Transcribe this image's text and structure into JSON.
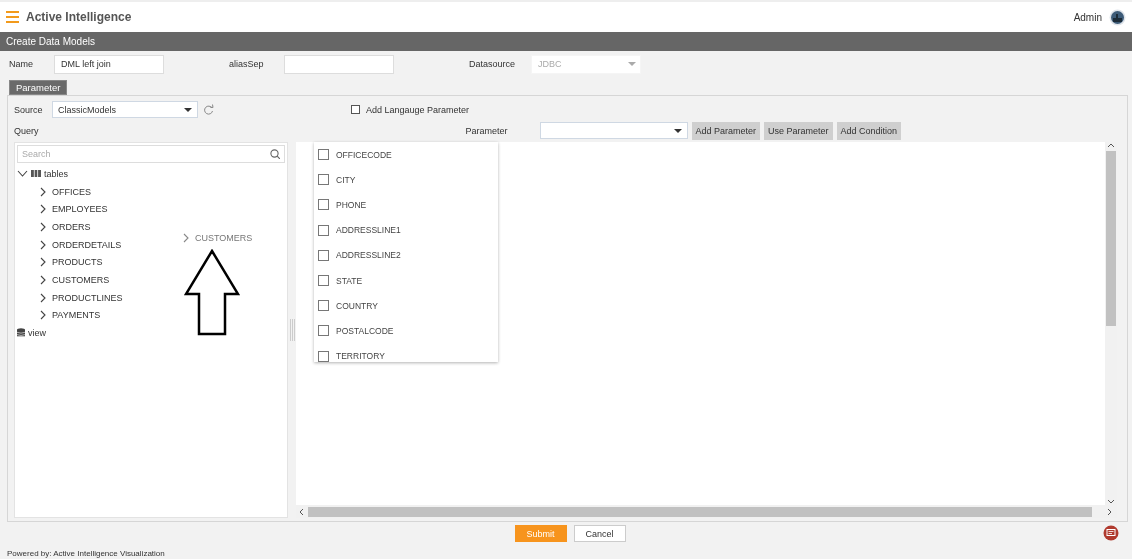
{
  "header": {
    "title": "Active Intelligence",
    "user": "Admin"
  },
  "page_title": "Create Data Models",
  "fields": [
    {
      "label": "Name",
      "kind": "text",
      "value": "DML left join"
    },
    {
      "label": "aliasSep",
      "kind": "text"
    },
    {
      "label": "Datasource",
      "kind": "select",
      "value": "JDBC",
      "disabled": true
    }
  ],
  "tabs": [
    {
      "label": "Parameter",
      "selected": true
    }
  ],
  "source": {
    "label": "Source",
    "value": "ClassicModels"
  },
  "language_checkbox": {
    "label": "Add Langauge Parameter",
    "checked": false
  },
  "query_label": "Query",
  "parameter": {
    "label": "Parameter"
  },
  "parameter_buttons": [
    "Add Parameter",
    "Use Parameter",
    "Add Condition"
  ],
  "tree": {
    "search": {
      "placeholder": "Search"
    },
    "nodes": [
      {
        "label": "tables",
        "kind": "table",
        "expanded": true,
        "children": [
          {
            "label": "OFFICES",
            "expanded": false
          },
          {
            "label": "EMPLOYEES",
            "expanded": false
          },
          {
            "label": "ORDERS",
            "expanded": false
          },
          {
            "label": "ORDERDETAILS",
            "expanded": false
          },
          {
            "label": "PRODUCTS",
            "expanded": false
          },
          {
            "label": "CUSTOMERS",
            "expanded": false
          },
          {
            "label": "PRODUCTLINES",
            "expanded": false
          },
          {
            "label": "PAYMENTS",
            "expanded": false
          }
        ]
      },
      {
        "label": "view",
        "kind": "view"
      }
    ]
  },
  "drag_item": "CUSTOMERS",
  "columns": [
    {
      "label": "OFFICECODE",
      "checked": false
    },
    {
      "label": "CITY",
      "checked": false
    },
    {
      "label": "PHONE",
      "checked": false
    },
    {
      "label": "ADDRESSLINE1",
      "checked": false
    },
    {
      "label": "ADDRESSLINE2",
      "checked": false
    },
    {
      "label": "STATE",
      "checked": false
    },
    {
      "label": "COUNTRY",
      "checked": false
    },
    {
      "label": "POSTALCODE",
      "checked": false
    },
    {
      "label": "TERRITORY",
      "checked": false
    }
  ],
  "actions": [
    {
      "label": "Submit",
      "kind": "primary"
    },
    {
      "label": "Cancel",
      "kind": "secondary"
    }
  ],
  "footer": "Powered by: Active Intelligence Visualization"
}
